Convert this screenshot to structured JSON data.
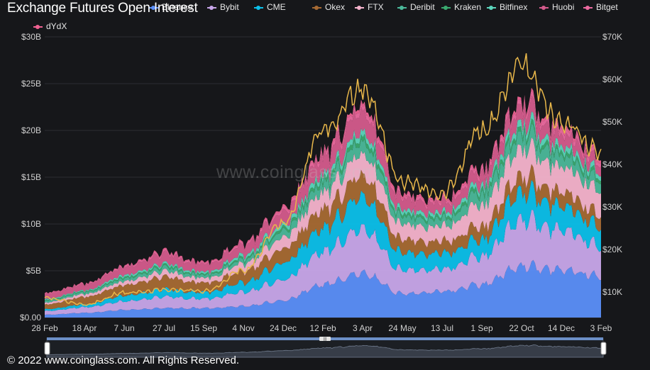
{
  "title": "Exchange Futures Open Interest",
  "watermark": "www.coinglass.com",
  "footer": "© 2022 www.coinglass.com. All Rights Reserved.",
  "navigator_handle": "|||",
  "chart_data": {
    "type": "area",
    "title": "Exchange Futures Open Interest",
    "stacked": true,
    "categories": [
      "28 Feb",
      "18 Apr",
      "7 Jun",
      "27 Jul",
      "15 Sep",
      "4 Nov",
      "24 Dec",
      "12 Feb",
      "3 Apr",
      "24 May",
      "13 Jul",
      "1 Sep",
      "22 Oct",
      "14 Dec",
      "3 Feb"
    ],
    "y_left": {
      "ticks": [
        "$0.00",
        "$5B",
        "$10B",
        "$15B",
        "$20B",
        "$25B",
        "$30B"
      ],
      "ylim": [
        0,
        30
      ],
      "unit": "B USD"
    },
    "y_right": {
      "ticks": [
        "$10K",
        "$20K",
        "$30K",
        "$40K",
        "$50K",
        "$60K",
        "$70K"
      ],
      "ylim": [
        4000,
        70000
      ],
      "unit": "USD"
    },
    "legend_position": "top",
    "grid": true,
    "series": [
      {
        "name": "Binance",
        "color": "#5b8ff9",
        "values": [
          0.3,
          0.5,
          0.8,
          1.0,
          1.0,
          1.2,
          1.8,
          3.5,
          4.8,
          2.5,
          2.8,
          3.5,
          5.5,
          5.0,
          4.5
        ]
      },
      {
        "name": "Bybit",
        "color": "#c8a6ea",
        "values": [
          0.4,
          0.6,
          0.9,
          1.2,
          1.0,
          1.5,
          2.2,
          3.5,
          4.8,
          2.5,
          2.4,
          3.0,
          5.0,
          4.2,
          3.3
        ]
      },
      {
        "name": "CME",
        "color": "#0cc0ea",
        "values": [
          0.2,
          0.3,
          0.6,
          0.8,
          0.7,
          1.0,
          1.8,
          2.5,
          3.5,
          1.8,
          1.7,
          1.8,
          3.0,
          2.5,
          2.2
        ]
      },
      {
        "name": "Okex",
        "color": "#a66a33",
        "values": [
          0.5,
          0.8,
          1.1,
          1.3,
          1.0,
          1.2,
          1.5,
          2.0,
          2.3,
          1.4,
          1.3,
          1.4,
          1.7,
          1.5,
          1.3
        ]
      },
      {
        "name": "FTX",
        "color": "#f5b3cc",
        "values": [
          0.2,
          0.3,
          0.4,
          0.6,
          0.5,
          0.8,
          1.2,
          1.8,
          2.3,
          1.6,
          1.6,
          2.3,
          3.0,
          2.6,
          2.6
        ]
      },
      {
        "name": "Deribit",
        "color": "#4bb89a",
        "values": [
          0.2,
          0.2,
          0.3,
          0.4,
          0.3,
          0.4,
          0.7,
          1.0,
          1.3,
          0.8,
          0.8,
          1.2,
          1.5,
          1.2,
          1.1
        ]
      },
      {
        "name": "Kraken",
        "color": "#3aaa6f",
        "values": [
          0.1,
          0.1,
          0.15,
          0.2,
          0.15,
          0.2,
          0.3,
          0.4,
          0.5,
          0.3,
          0.3,
          0.4,
          0.5,
          0.4,
          0.4
        ]
      },
      {
        "name": "Bitfinex",
        "color": "#5cd6bd",
        "values": [
          0.1,
          0.1,
          0.2,
          0.2,
          0.2,
          0.3,
          0.4,
          0.5,
          0.6,
          0.4,
          0.4,
          0.5,
          0.7,
          0.6,
          0.5
        ]
      },
      {
        "name": "Huobi",
        "color": "#d45b8c",
        "values": [
          0.5,
          0.6,
          0.8,
          1.0,
          0.8,
          1.0,
          1.3,
          1.8,
          2.2,
          1.2,
          1.0,
          1.2,
          1.6,
          1.2,
          1.0
        ]
      },
      {
        "name": "Bitget",
        "color": "#ec6aa0",
        "values": [
          0.1,
          0.1,
          0.15,
          0.2,
          0.15,
          0.2,
          0.3,
          0.4,
          0.5,
          0.3,
          0.3,
          0.4,
          0.5,
          0.5,
          0.4
        ]
      },
      {
        "name": "dYdX",
        "color": "#f06292",
        "values": [
          0.05,
          0.05,
          0.05,
          0.1,
          0.1,
          0.1,
          0.15,
          0.2,
          0.3,
          0.2,
          0.2,
          0.2,
          0.3,
          0.3,
          0.3
        ]
      }
    ],
    "price_series": {
      "color": "#e8b74a",
      "axis": "right",
      "values": [
        8700,
        7000,
        9800,
        10500,
        10200,
        15000,
        26000,
        48000,
        58000,
        36000,
        33000,
        48000,
        63000,
        50000,
        43000
      ]
    }
  }
}
